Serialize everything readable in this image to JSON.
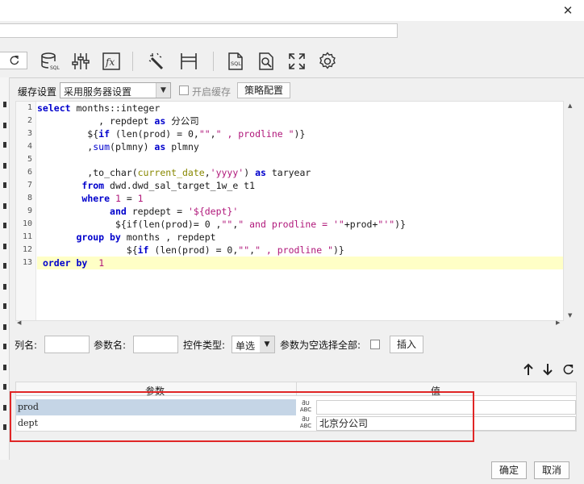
{
  "window": {
    "close_glyph": "✕"
  },
  "toolbar": {
    "icons": [
      "refresh-icon",
      "database-sql-icon",
      "sliders-icon",
      "function-fx-icon",
      "magic-wand-icon",
      "column-width-icon",
      "sql-file-icon",
      "search-document-icon",
      "fullscreen-icon",
      "settings-gear-icon"
    ]
  },
  "cache": {
    "label": "缓存设置",
    "select_value": "采用服务器设置",
    "enable_label": "开启缓存",
    "strategy_button": "策略配置"
  },
  "editor": {
    "line_numbers": [
      "1",
      "2",
      "3",
      "4",
      "5",
      "6",
      "7",
      "8",
      "9",
      "10",
      "11",
      "12",
      "13"
    ],
    "active_line": 13
  },
  "params_form": {
    "column_name_label": "列名:",
    "param_name_label": "参数名:",
    "control_type_label": "控件类型:",
    "control_type_value": "单选",
    "empty_select_all_label": "参数为空选择全部:",
    "insert_button": "插入"
  },
  "param_table": {
    "headers": [
      "参数",
      "值"
    ],
    "rows": [
      {
        "name": "prod",
        "value": ""
      },
      {
        "name": "dept",
        "value": "北京分公司"
      }
    ],
    "type_badge_top": "ƌU",
    "type_badge_bottom": "ABC"
  },
  "footer": {
    "ok_button": "确定",
    "cancel_button": "取消"
  },
  "colors": {
    "keyword": "#0000cc",
    "string": "#b0177a",
    "function": "#888800",
    "active_line": "#ffffc6",
    "selected_row": "#c5d5e6",
    "highlight_box": "#e02626"
  }
}
